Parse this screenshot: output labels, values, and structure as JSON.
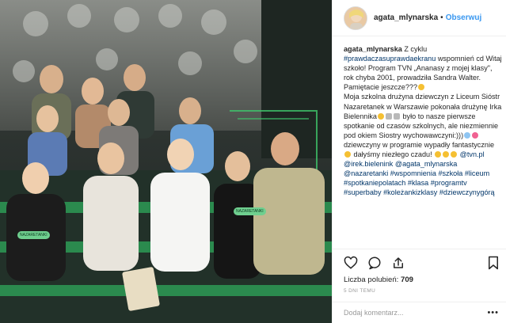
{
  "post": {
    "username": "agata_mlynarska",
    "separator": "•",
    "follow_label": "Obserwuj"
  },
  "caption": {
    "username": "agata_mlynarska",
    "p1": "Z cyklu",
    "tag_prawda": "#prawdaczasuprawdaekranu",
    "p2": "wspomnień cd Witaj szkoło! Program TVN „Ananasy z mojej klasy\", rok chyba 2001, prowadziła Sandra Walter. Pamiętacie jeszcze???",
    "p3": "Moja szkolna drużyna dziewczyn z Liceum Sióstr Nazaretanek w Warszawie pokonała drużynę Irka Bielennika",
    "p4": "było to nasze pierwsze spotkanie od czasów szkolnych, ale niezmiennie pod okiem Siostry wychowawczyni:)))",
    "p5": "dziewczyny w programie wypadły fantastycznie",
    "p6": "dałyśmy niezłego czadu!",
    "mention_tvn": "@tvn.pl",
    "mention_irek": "@irek.bielenink",
    "mention_agata": "@agata_mlynarska",
    "mention_nazaretanki": "@nazaretanki",
    "tag_wspomnienia": "#wspomnienia",
    "tag_szkola": "#szkoła",
    "tag_liceum": "#liceum",
    "tag_spotkanie": "#spotkaniepolatach",
    "tag_klasa": "#klasa",
    "tag_programtv": "#programtv",
    "tag_superbaby": "#superbaby",
    "tag_kolezanki": "#koleżankizklasy",
    "tag_dziewczyny": "#dziewczynygórą"
  },
  "engagement": {
    "likes_label": "Liczba polubień:",
    "likes_count": "709",
    "time_ago": "5 DNI TEMU"
  },
  "comment": {
    "placeholder": "Dodaj komentarz..."
  },
  "photo": {
    "badge_left": "NAZARETANKI",
    "badge_right": "NAZARETANKI"
  },
  "icons": {
    "like": "heart-icon",
    "comment": "comment-icon",
    "share": "share-icon",
    "save": "bookmark-icon",
    "more": "more-options-icon"
  },
  "colors": {
    "link": "#003569",
    "follow": "#3897f0",
    "stage_green": "#2b8a4e",
    "backdrop": "#1f2a26"
  }
}
